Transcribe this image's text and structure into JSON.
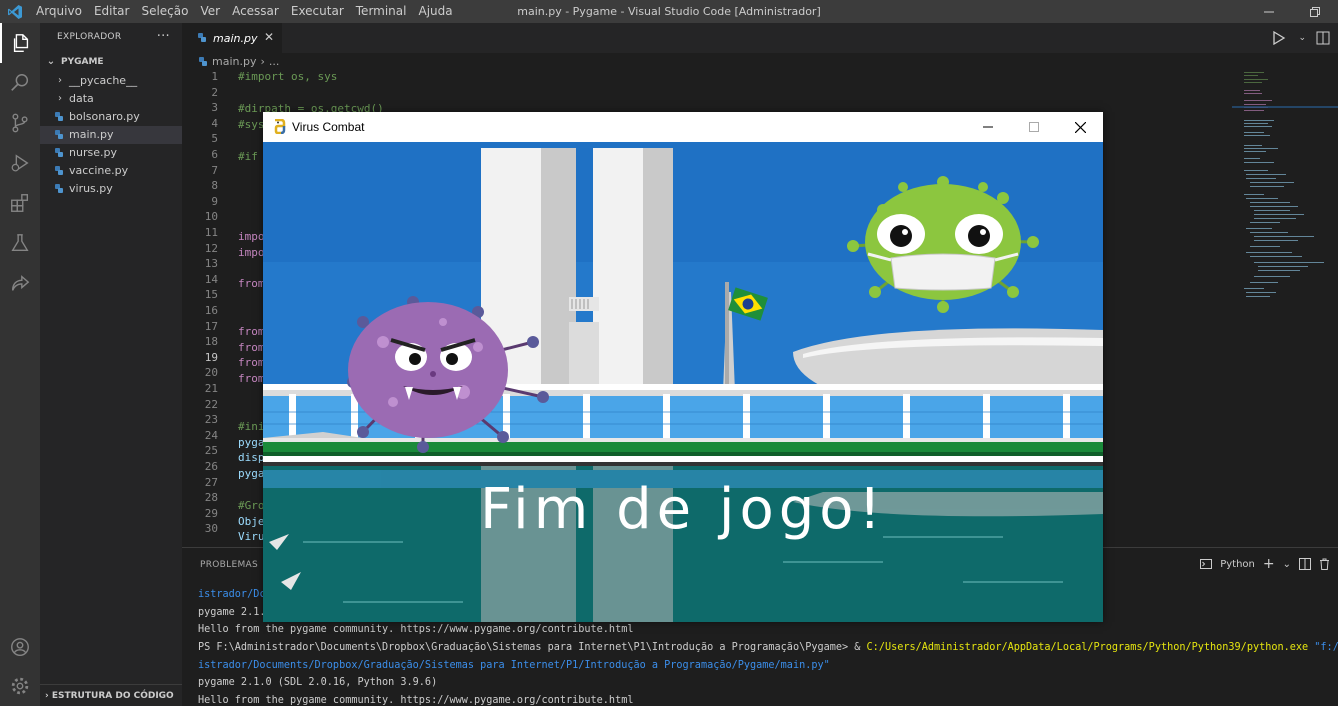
{
  "titlebar": {
    "menus": [
      "Arquivo",
      "Editar",
      "Seleção",
      "Ver",
      "Acessar",
      "Executar",
      "Terminal",
      "Ajuda"
    ],
    "window_title": "main.py - Pygame - Visual Studio Code [Administrador]"
  },
  "sidebar": {
    "header": "EXPLORADOR",
    "more": "···",
    "section": "PYGAME",
    "folders": [
      "__pycache__",
      "data"
    ],
    "files": [
      "bolsonaro.py",
      "main.py",
      "nurse.py",
      "vaccine.py",
      "virus.py"
    ],
    "selected_file": "main.py",
    "footer": "ESTRUTURA DO CÓDIGO"
  },
  "editor": {
    "tab_label": "main.py",
    "breadcrumb_file": "main.py",
    "breadcrumb_more": "...",
    "current_line": 19,
    "line_numbers": [
      "1",
      "2",
      "3",
      "4",
      "5",
      "6",
      "7",
      "8",
      "9",
      "10",
      "11",
      "12",
      "13",
      "14",
      "15",
      "16",
      "17",
      "18",
      "19",
      "20",
      "21",
      "22",
      "23",
      "24",
      "25",
      "26",
      "27",
      "28",
      "29",
      "30"
    ],
    "code": {
      "l1": "#import os, sys",
      "l3": "#dirpath = os.getcwd()",
      "l4": "#sys",
      "l6": "#if",
      "l11": "impo",
      "l12": "impo",
      "l14": "from",
      "l17": "from",
      "l18": "from",
      "l19": "from",
      "l20": "from",
      "l23": "#ini",
      "l24": "pyga",
      "l25": "disp",
      "l26": "pyga",
      "l28": "#Gro",
      "l29": "Obje",
      "l30": "Viru"
    }
  },
  "panel": {
    "tab": "PROBLEMAS",
    "shell": "Python",
    "terminal": {
      "l1": "istrador/Dc",
      "l2": "pygame 2.1.",
      "l3": "Hello from the pygame community. https://www.pygame.org/contribute.html",
      "l4_prompt": "PS F:\\Administrador\\Documents\\Dropbox\\Graduação\\Sistemas para Internet\\P1\\Introdução a Programação\\Pygame> & ",
      "l4_cmd": "C:/Users/Administrador/AppData/Local/Programs/Python/Python39/python.exe",
      "l4_arg": " \"f:/Admi",
      "l5": "istrador/Documents/Dropbox/Graduação/Sistemas para Internet/P1/Introdução a Programação/Pygame/main.py\"",
      "l6": "pygame 2.1.0 (SDL 2.0.16, Python 3.9.6)",
      "l7": "Hello from the pygame community. https://www.pygame.org/contribute.html"
    }
  },
  "game": {
    "window_title": "Virus Combat",
    "message": "Fim de jogo!"
  },
  "colors": {
    "sky": "#1e74c6",
    "building": "#dcdcdc",
    "virus_green": "#8cc63f",
    "virus_purple": "#9b6bb3",
    "water": "#0f6a6a"
  }
}
